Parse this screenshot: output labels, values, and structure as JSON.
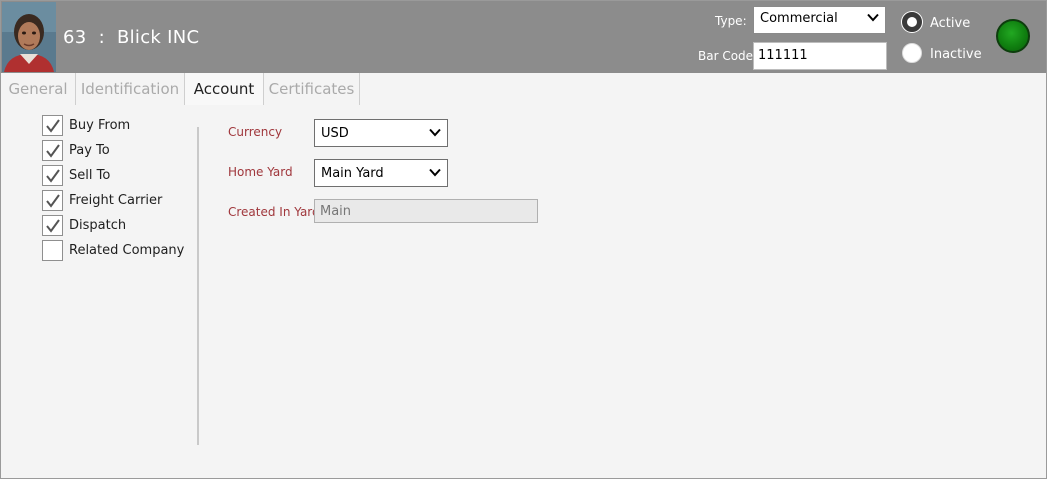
{
  "header": {
    "id": "63",
    "separator": ":",
    "company_name": "Blick INC",
    "type_label": "Type:",
    "type_value": "Commercial",
    "barcode_label": "Bar Code",
    "barcode_value": "111111",
    "status_options": [
      {
        "label": "Active",
        "selected": true
      },
      {
        "label": "Inactive",
        "selected": false
      }
    ],
    "status_light_color": "#1a8f1a"
  },
  "tabs": [
    {
      "label": "General",
      "active": false
    },
    {
      "label": "Identification",
      "active": false
    },
    {
      "label": "Account",
      "active": true
    },
    {
      "label": "Certificates",
      "active": false
    }
  ],
  "roles": [
    {
      "label": "Buy From",
      "checked": true
    },
    {
      "label": "Pay To",
      "checked": true
    },
    {
      "label": "Sell To",
      "checked": true
    },
    {
      "label": "Freight Carrier",
      "checked": true
    },
    {
      "label": "Dispatch",
      "checked": true
    },
    {
      "label": "Related Company",
      "checked": false
    }
  ],
  "account": {
    "currency_label": "Currency",
    "currency_value": "USD",
    "home_yard_label": "Home Yard",
    "home_yard_value": "Main Yard",
    "created_in_yard_label": "Created In Yard",
    "created_in_yard_value": "Main"
  },
  "colors": {
    "header_bg": "#8c8c8c",
    "field_label": "#a0373c",
    "status_active": "#1a8f1a"
  }
}
